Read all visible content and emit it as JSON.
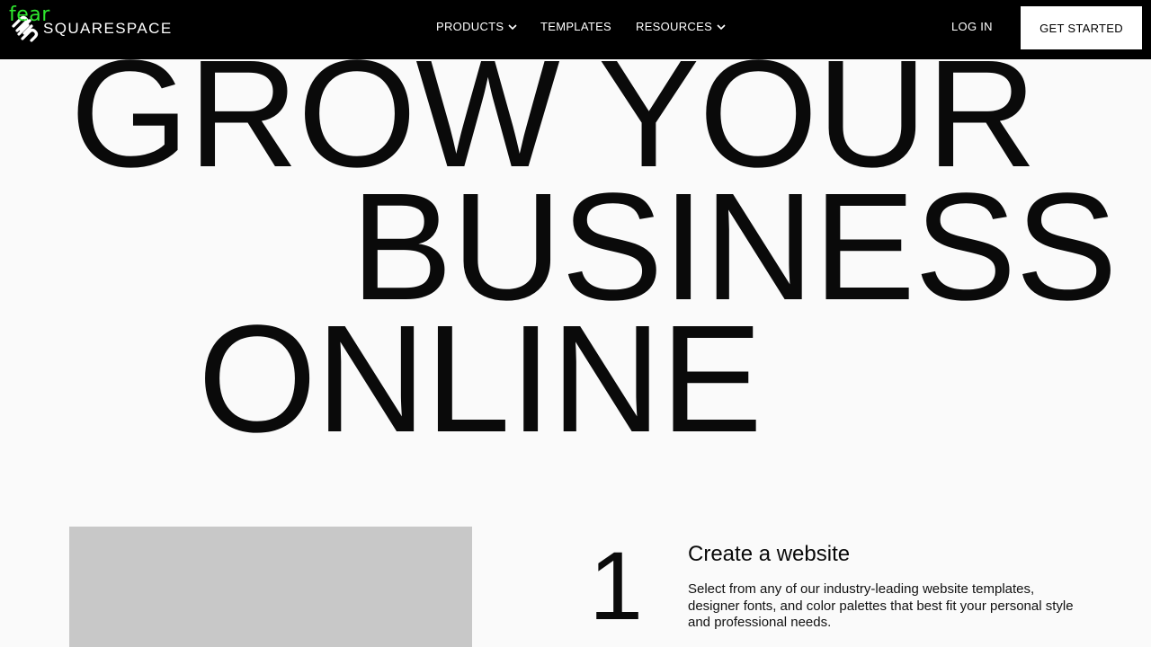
{
  "overlay": {
    "tag": "fear"
  },
  "nav": {
    "brand": "SQUARESPACE",
    "items": [
      {
        "label": "PRODUCTS",
        "has_menu": true
      },
      {
        "label": "TEMPLATES",
        "has_menu": false
      },
      {
        "label": "RESOURCES",
        "has_menu": true
      }
    ],
    "login": "LOG IN",
    "cta": "GET STARTED"
  },
  "hero": {
    "lines": [
      "GROW YOUR",
      "BUSINESS",
      "ONLINE"
    ]
  },
  "steps": [
    {
      "number": "1",
      "title": "Create a website",
      "description": "Select from any of our industry-leading website templates, designer fonts, and color palettes that best fit your personal style and professional needs."
    }
  ],
  "colors": {
    "nav_bg": "#000000",
    "page_bg": "#fafafa",
    "text": "#0a0a0a",
    "overlay_tag": "#2ee82e",
    "placeholder": "#c8c8c8"
  },
  "icons": {
    "logo": "squarespace-logo-icon",
    "menu_caret": "chevron-down-icon"
  }
}
